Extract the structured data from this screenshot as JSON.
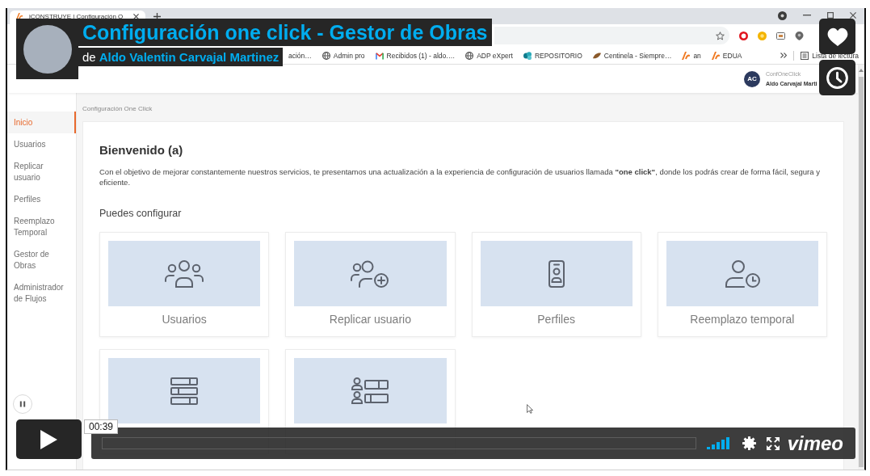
{
  "video_player": {
    "title": "Configuración one click - Gestor de Obras",
    "byline": {
      "prefix": "de",
      "author": "Aldo Valentin Carvajal Martinez"
    },
    "time": "00:39",
    "logo": "vimeo"
  },
  "browser": {
    "tab": {
      "title": "iCONSTRUYE | Configuración O"
    },
    "bookmarks": [
      {
        "label": "ación…"
      },
      {
        "label": "Admin pro"
      },
      {
        "label": "Recibidos (1) - aldo.…"
      },
      {
        "label": "ADP eXpert"
      },
      {
        "label": "REPOSITORIO"
      },
      {
        "label": "Centinela - Siempre…"
      },
      {
        "label": "an"
      },
      {
        "label": "EDUA"
      }
    ],
    "reading_list": "Lista de lectura"
  },
  "app": {
    "user": {
      "initials": "AC",
      "account": "ConfOneClick",
      "name": "Aldo Carvajal Marti"
    },
    "sidebar": {
      "items": [
        {
          "label": "Inicio",
          "selected": true
        },
        {
          "label": "Usuarios",
          "selected": false
        },
        {
          "label": "Replicar usuario",
          "selected": false
        },
        {
          "label": "Perfiles",
          "selected": false
        },
        {
          "label": "Reemplazo Temporal",
          "selected": false
        },
        {
          "label": "Gestor de Obras",
          "selected": false
        },
        {
          "label": "Administrador de Flujos",
          "selected": false
        }
      ]
    },
    "breadcrumb": "Configuración One Click",
    "welcome": {
      "heading": "Bienvenido (a)",
      "text": "Con el objetivo de mejorar constantemente nuestros servicios, te presentamos una actualización a la experiencia de configuración de usuarios llamada **\"one click\"**, donde los podrás crear de forma fácil, segura y eficiente.",
      "subheading": "Puedes configurar"
    },
    "tiles": [
      {
        "kind": "users",
        "label": "Usuarios"
      },
      {
        "kind": "user-plus",
        "label": "Replicar usuario"
      },
      {
        "kind": "badge",
        "label": "Perfiles"
      },
      {
        "kind": "user-clock",
        "label": "Reemplazo temporal"
      },
      {
        "kind": "table"
      },
      {
        "kind": "user-list"
      }
    ]
  }
}
